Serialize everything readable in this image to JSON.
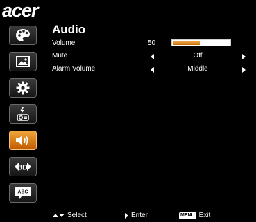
{
  "brand": {
    "logo_text": "acer"
  },
  "sidebar": {
    "items": [
      {
        "name": "color",
        "icon": "palette-icon",
        "active": false
      },
      {
        "name": "image",
        "icon": "picture-icon",
        "active": false
      },
      {
        "name": "settings",
        "icon": "gear-icon",
        "active": false
      },
      {
        "name": "management",
        "icon": "projector-icon",
        "active": false
      },
      {
        "name": "audio",
        "icon": "speaker-icon",
        "active": true
      },
      {
        "name": "3d",
        "icon": "3d-icon",
        "active": false,
        "label": "3D"
      },
      {
        "name": "language",
        "icon": "speech-bubble-icon",
        "active": false,
        "label": "ABC"
      }
    ]
  },
  "main": {
    "title": "Audio",
    "rows": [
      {
        "label": "Volume",
        "value": "50",
        "level": 0.5
      },
      {
        "label": "Mute",
        "value": "Off"
      },
      {
        "label": "Alarm Volume",
        "value": "Middle"
      }
    ]
  },
  "footer": {
    "select_label": "Select",
    "enter_label": "Enter",
    "menu_key": "MENU",
    "exit_label": "Exit"
  },
  "colors": {
    "accent": "#e8902a",
    "background": "#000000"
  }
}
